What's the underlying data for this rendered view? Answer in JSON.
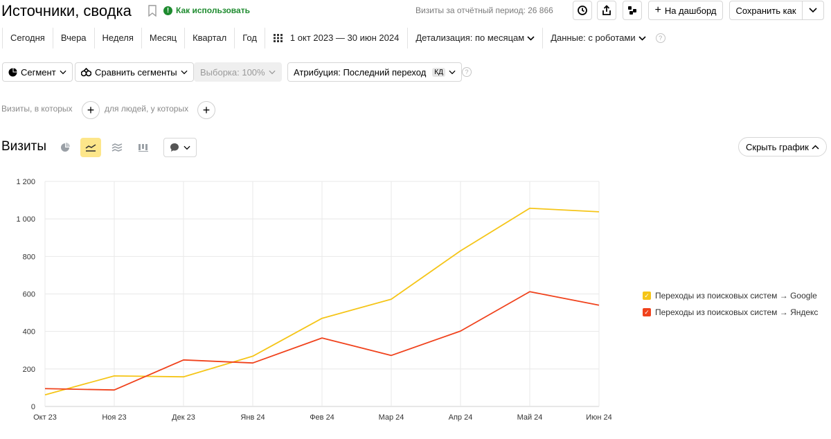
{
  "header": {
    "title": "Источники, сводка",
    "help_link": "Как использовать",
    "visits_summary": "Визиты за отчётный период: 26 866",
    "add_dashboard": "На дашборд",
    "save_as": "Сохранить как",
    "icons": [
      "history-icon",
      "export-icon",
      "widgets-icon"
    ]
  },
  "period": {
    "presets": [
      "Сегодня",
      "Вчера",
      "Неделя",
      "Месяц",
      "Квартал",
      "Год"
    ],
    "date_range": "1 окт 2023 — 30 июн 2024",
    "detail": "Детализация: по месяцам",
    "robots": "Данные: с роботами"
  },
  "segments": {
    "segment": "Сегмент",
    "compare": "Сравнить сегменты",
    "sample": "Выборка: 100%",
    "attribution": "Атрибуция: Последний переход",
    "attribution_badge": "КД"
  },
  "filters": {
    "visits_prefix": "Визиты, в которых",
    "people_prefix": "для людей, у которых"
  },
  "chart_section": {
    "title": "Визиты",
    "hide_chart": "Скрыть график",
    "active_view": "line",
    "views": [
      "pie-chart-icon",
      "line-chart-icon",
      "area-chart-icon",
      "bar-chart-icon"
    ]
  },
  "chart_data": {
    "type": "line",
    "categories": [
      "Окт 23",
      "Ноя 23",
      "Дек 23",
      "Янв 24",
      "Фев 24",
      "Мар 24",
      "Апр 24",
      "Май 24",
      "Июн 24"
    ],
    "ylim": [
      0,
      1200
    ],
    "yticks": [
      0,
      200,
      400,
      600,
      800,
      1000,
      1200
    ],
    "ytick_labels": [
      "0",
      "200",
      "400",
      "600",
      "800",
      "1 000",
      "1 200"
    ],
    "grid": true,
    "legend_position": "right",
    "series": [
      {
        "name": "Переходы из поисковых систем → Google",
        "color": "#f5c518",
        "values": [
          62,
          163,
          158,
          268,
          470,
          572,
          830,
          1057,
          1038
        ]
      },
      {
        "name": "Переходы из поисковых систем → Яндекс",
        "color": "#f0421c",
        "values": [
          95,
          88,
          248,
          232,
          365,
          272,
          402,
          612,
          540
        ]
      }
    ]
  }
}
